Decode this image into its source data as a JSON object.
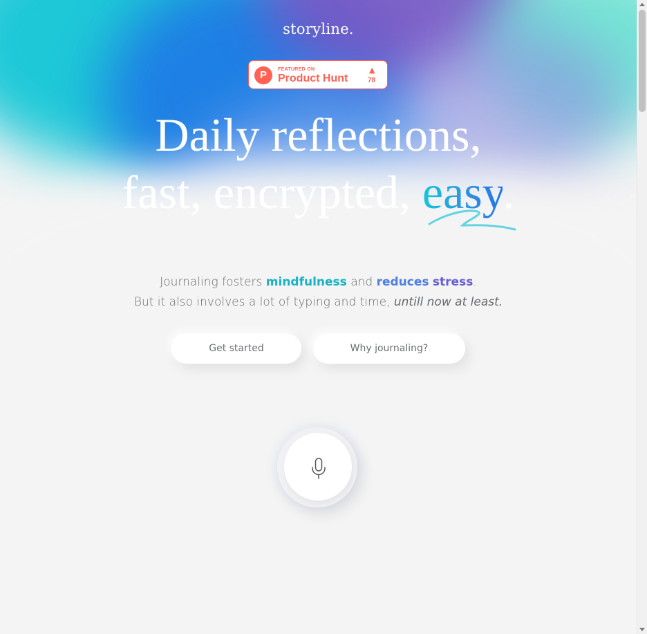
{
  "brand": {
    "name": "storyline."
  },
  "product_hunt": {
    "featured_label": "FEATURED ON",
    "name": "Product Hunt",
    "logo_letter": "P",
    "upvote_arrow": "▲",
    "upvotes": "78",
    "color": "#ff6154"
  },
  "hero": {
    "line1": "Daily reflections,",
    "line2_prefix": "fast, encrypted, ",
    "line2_highlight": "easy",
    "line2_suffix": "."
  },
  "tagline": {
    "part1": "Journaling fosters ",
    "mindfulness": "mindfulness",
    "and": " and ",
    "reduces": "reduces",
    "space": " ",
    "stress": "stress",
    "period": ".",
    "line2_prefix": "But it also involves a lot of typing and time, ",
    "line2_italic": "untill now at least."
  },
  "buttons": {
    "get_started": "Get started",
    "why_journaling": "Why journaling?"
  },
  "mic": {
    "icon": "microphone-icon"
  },
  "colors": {
    "accent_teal": "#17b3c4",
    "accent_blue": "#4f7fe0",
    "accent_purple": "#6a5fd0",
    "background": "#f4f4f4"
  }
}
